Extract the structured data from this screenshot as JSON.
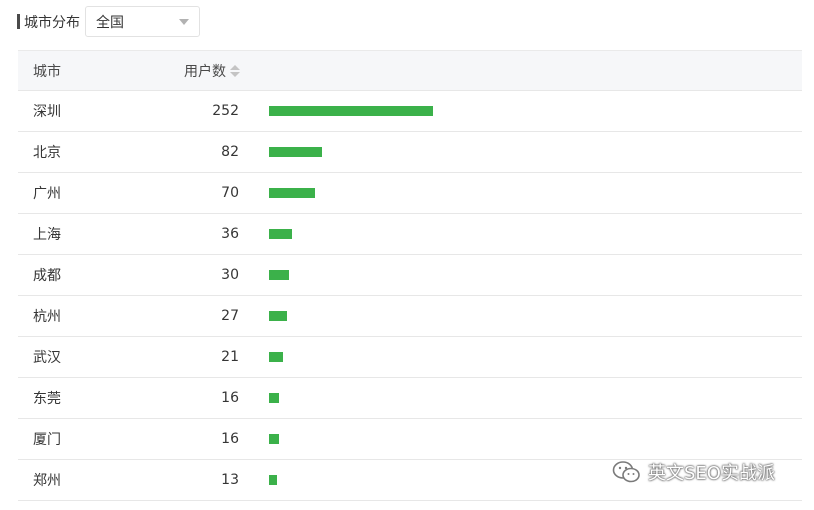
{
  "header": {
    "title": "城市分布",
    "region_select": {
      "selected": "全国"
    }
  },
  "table": {
    "columns": {
      "city": "城市",
      "users": "用户数"
    },
    "max_users": 252,
    "rows": [
      {
        "city": "深圳",
        "users": "252",
        "value": 252
      },
      {
        "city": "北京",
        "users": "82",
        "value": 82
      },
      {
        "city": "广州",
        "users": "70",
        "value": 70
      },
      {
        "city": "上海",
        "users": "36",
        "value": 36
      },
      {
        "city": "成都",
        "users": "30",
        "value": 30
      },
      {
        "city": "杭州",
        "users": "27",
        "value": 27
      },
      {
        "city": "武汉",
        "users": "21",
        "value": 21
      },
      {
        "city": "东莞",
        "users": "16",
        "value": 16
      },
      {
        "city": "厦门",
        "users": "16",
        "value": 16
      },
      {
        "city": "郑州",
        "users": "13",
        "value": 13
      }
    ]
  },
  "colors": {
    "bar": "#3bb14a",
    "header_bg": "#f6f7f9"
  },
  "watermark": {
    "icon": "wechat-icon",
    "text": "英文SEO实战派"
  }
}
